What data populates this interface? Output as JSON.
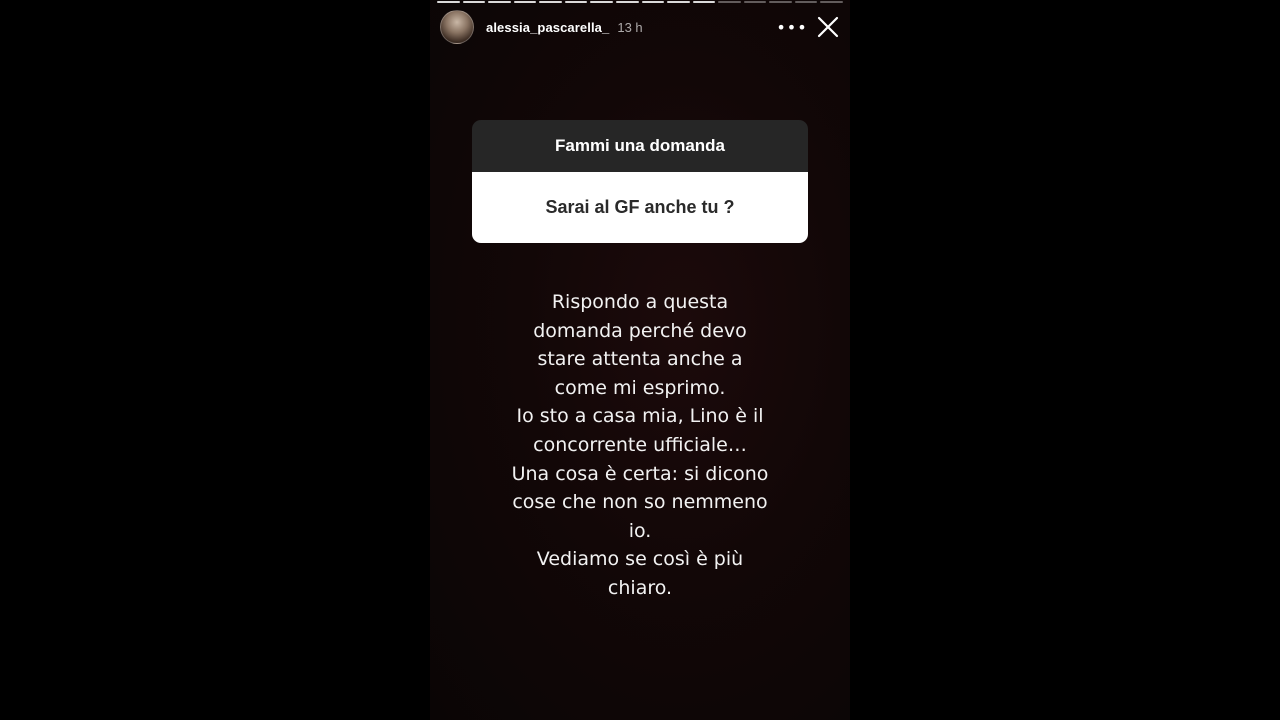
{
  "story": {
    "progress_segments": 16,
    "progress_seen": 11,
    "header": {
      "username": "alessia_pascarella_",
      "time": "13 h",
      "more_label": "•••",
      "avatar_icon": "profile-photo",
      "close_icon": "close-icon"
    },
    "question_sticker": {
      "title": "Fammi una domanda",
      "question": "Sarai al GF anche tu ?"
    },
    "message_lines": [
      "Rispondo a questa",
      "domanda perché devo",
      "stare attenta anche a",
      "come mi esprimo.",
      "Io sto a casa mia, Lino è il",
      "concorrente ufficiale…",
      "Una cosa è certa: si dicono",
      "cose che non so nemmeno",
      "io.",
      "Vediamo se così è più",
      "chiaro."
    ],
    "colors": {
      "background_outer": "#000000",
      "sticker_header": "#262626",
      "sticker_body": "#ffffff",
      "text": "#f2f2f2"
    }
  }
}
